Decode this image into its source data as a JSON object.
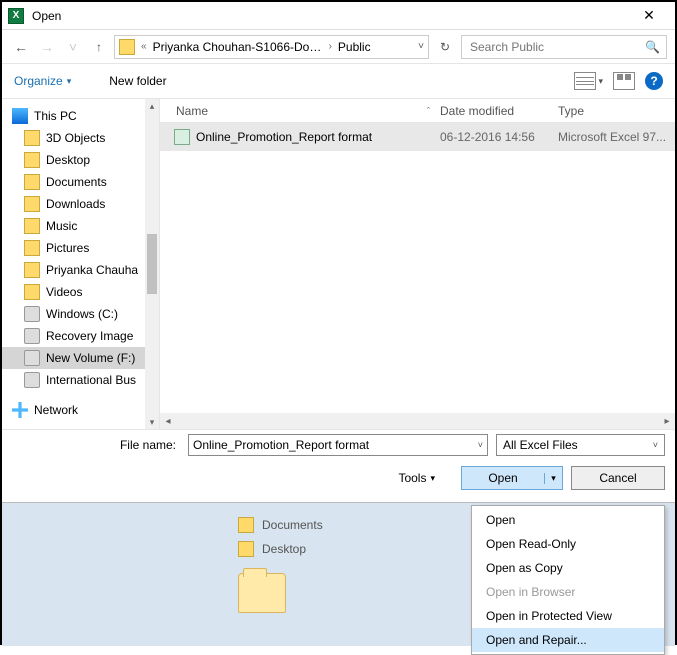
{
  "window": {
    "title": "Open",
    "close_glyph": "✕"
  },
  "nav": {
    "back_glyph": "←",
    "fwd_glyph": "→",
    "recent_glyph": "˅",
    "up_glyph": "↑",
    "refresh_glyph": "↻",
    "chev": "›"
  },
  "address": {
    "prefix": "«",
    "crumb1": "Priyanka Chouhan-S1066-Doc...",
    "crumb2": "Public",
    "dd": "˅"
  },
  "search": {
    "placeholder": "Search Public",
    "glyph": "🔍"
  },
  "toolbar": {
    "organize": "Organize",
    "organize_arrow": "▾",
    "newfolder": "New folder",
    "view_dd": "▾",
    "help": "?"
  },
  "columns": {
    "name": "Name",
    "sort": "ˆ",
    "date": "Date modified",
    "type": "Type"
  },
  "tree": {
    "items": [
      {
        "label": "This PC",
        "top": true,
        "icon": "pc"
      },
      {
        "label": "3D Objects",
        "icon": "folder"
      },
      {
        "label": "Desktop",
        "icon": "folder"
      },
      {
        "label": "Documents",
        "icon": "folder"
      },
      {
        "label": "Downloads",
        "icon": "folder"
      },
      {
        "label": "Music",
        "icon": "folder"
      },
      {
        "label": "Pictures",
        "icon": "folder"
      },
      {
        "label": "Priyanka Chauha",
        "icon": "folder"
      },
      {
        "label": "Videos",
        "icon": "folder"
      },
      {
        "label": "Windows (C:)",
        "icon": "disk"
      },
      {
        "label": "Recovery Image",
        "icon": "disk"
      },
      {
        "label": "New Volume (F:)",
        "icon": "disk",
        "sel": true
      },
      {
        "label": "International Bus",
        "icon": "disk"
      },
      {
        "label": "Network",
        "top": true,
        "icon": "net"
      }
    ]
  },
  "file": {
    "name": "Online_Promotion_Report  format",
    "date": "06-12-2016 14:56",
    "type": "Microsoft Excel 97..."
  },
  "filename": {
    "label": "File name:",
    "value": "Online_Promotion_Report  format",
    "dd": "˅"
  },
  "filter": {
    "value": "All Excel Files",
    "dd": "˅"
  },
  "tools": {
    "label": "Tools",
    "dd": "▾"
  },
  "buttons": {
    "open": "Open",
    "open_dd": "▾",
    "cancel": "Cancel"
  },
  "menu": {
    "open": "Open",
    "readonly": "Open Read-Only",
    "copy": "Open as Copy",
    "browser": "Open in Browser",
    "protected": "Open in Protected View",
    "repair": "Open and Repair..."
  },
  "under": {
    "docs": "Documents",
    "desk": "Desktop"
  }
}
